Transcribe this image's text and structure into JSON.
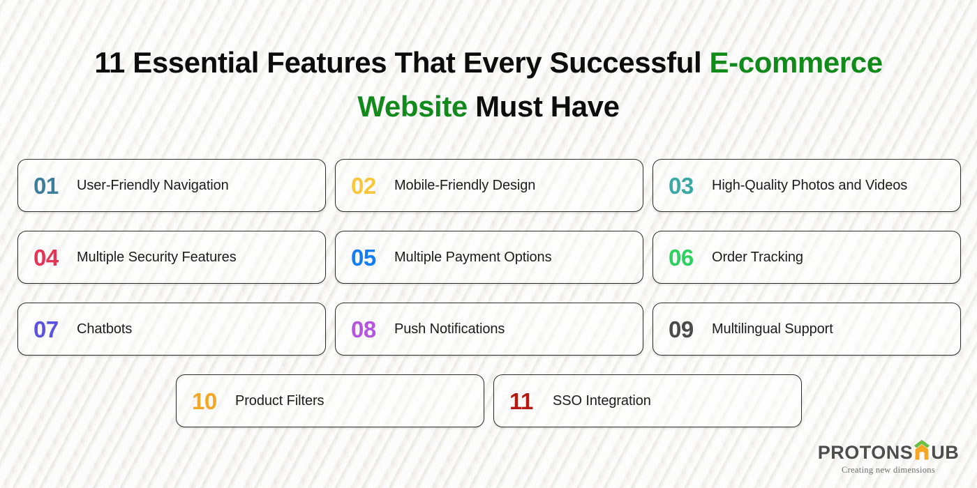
{
  "page": {
    "background_color": "#f6f5f3",
    "accent_color": "#128a1b"
  },
  "title": {
    "line1_part1": "11 Essential Features That Every Successful ",
    "line1_accent": "E-commerce",
    "line2_accent": "Website",
    "line2_part2": " Must Have",
    "full_text": "11 Essential Features That Every Successful E-commerce Website Must Have"
  },
  "cards": [
    {
      "number": "01",
      "label": "User-Friendly Navigation",
      "color": "#3c7d99"
    },
    {
      "number": "02",
      "label": "Mobile-Friendly Design",
      "color": "#f9c63c"
    },
    {
      "number": "03",
      "label": "High-Quality Photos and Videos",
      "color": "#3aa9a3"
    },
    {
      "number": "04",
      "label": "Multiple Security Features",
      "color": "#e63456"
    },
    {
      "number": "05",
      "label": "Multiple Payment Options",
      "color": "#137df5"
    },
    {
      "number": "06",
      "label": "Order Tracking",
      "color": "#2ed160"
    },
    {
      "number": "07",
      "label": "Chatbots",
      "color": "#5a52e0"
    },
    {
      "number": "08",
      "label": "Push Notifications",
      "color": "#b654e0"
    },
    {
      "number": "09",
      "label": "Multilingual Support",
      "color": "#4a4a4a"
    },
    {
      "number": "10",
      "label": "Product Filters",
      "color": "#f5a623"
    },
    {
      "number": "11",
      "label": "SSO Integration",
      "color": "#b51a12"
    }
  ],
  "logo": {
    "word_before": "PROTONS",
    "word_after": "UB",
    "tagline": "Creating new dimensions",
    "text_color": "#4d4d4d",
    "house_body_color": "#f5a623",
    "house_roof_color": "#6cbe45"
  }
}
